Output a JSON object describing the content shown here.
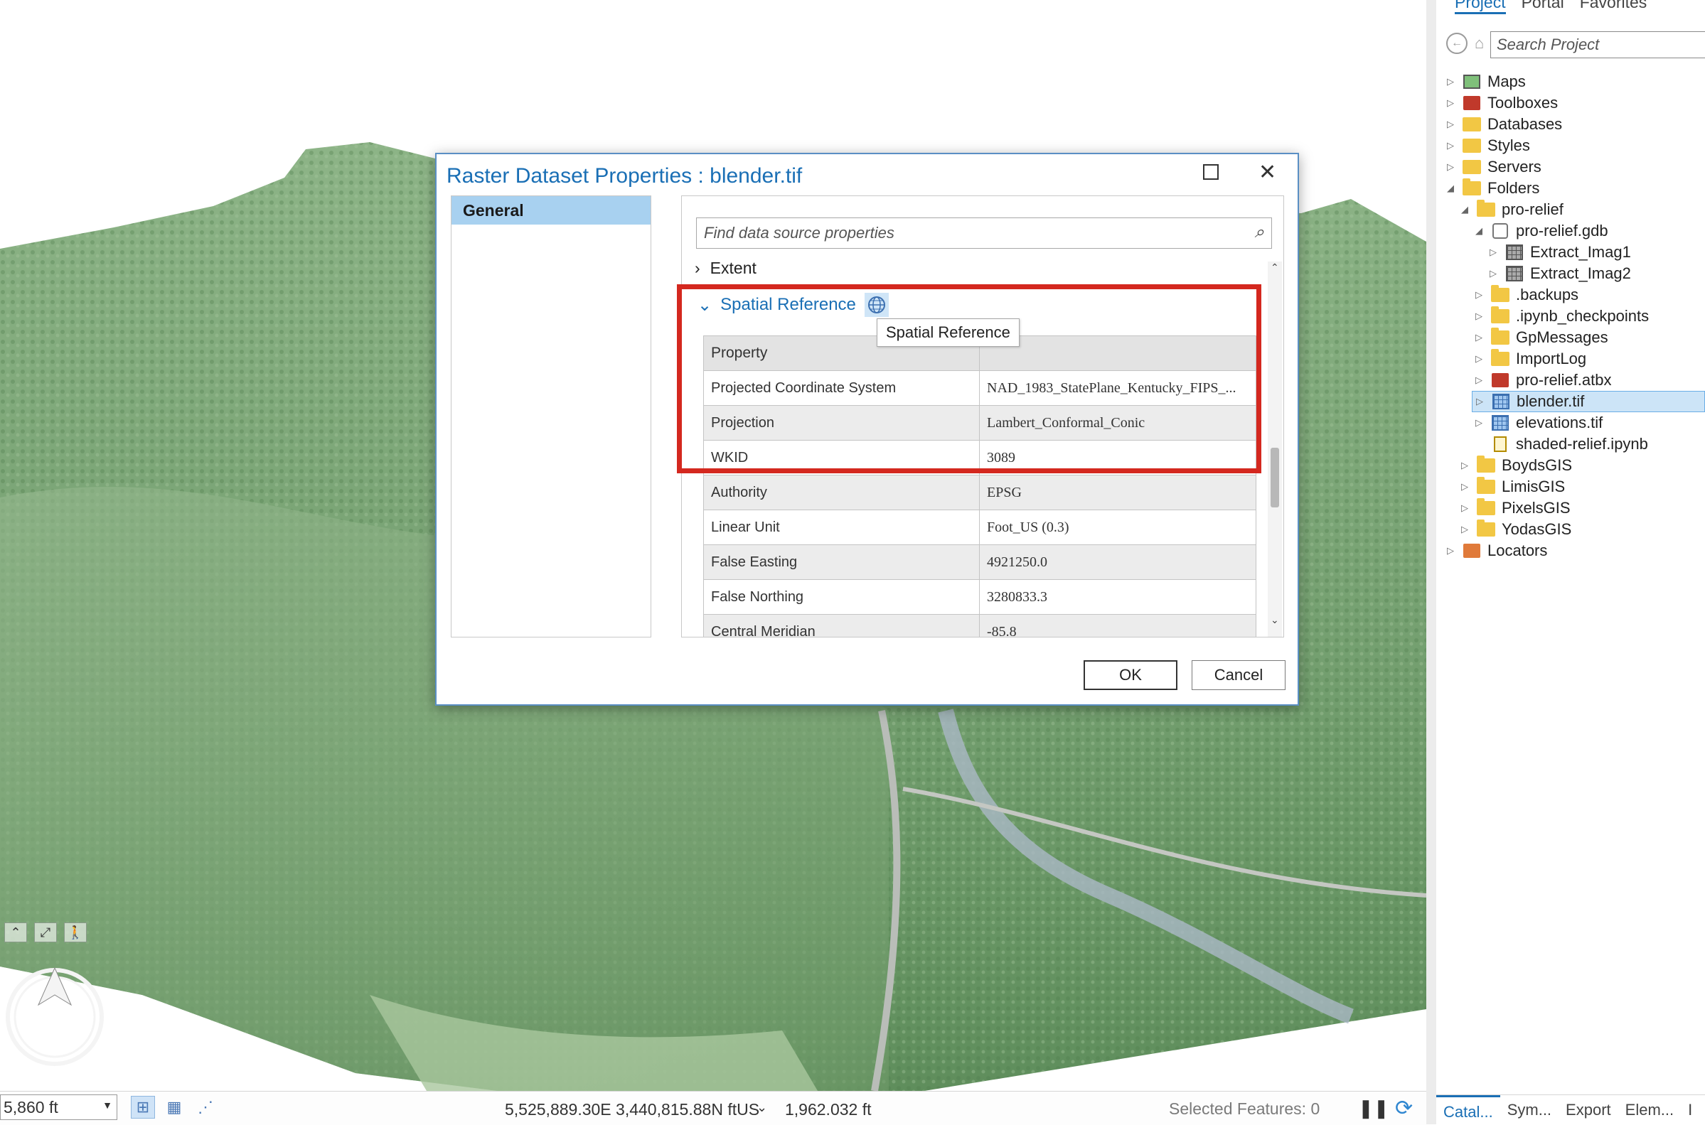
{
  "dialog": {
    "title": "Raster Dataset Properties : blender.tif",
    "nav_items": [
      "General"
    ],
    "search_placeholder": "Find data source properties",
    "extent_label": "Extent",
    "spatial_ref_label": "Spatial Reference",
    "tooltip": "Spatial Reference",
    "table": {
      "header": "Property",
      "rows": [
        {
          "property": "Projected Coordinate System",
          "value": "NAD_1983_StatePlane_Kentucky_FIPS_..."
        },
        {
          "property": "Projection",
          "value": "Lambert_Conformal_Conic"
        },
        {
          "property": "WKID",
          "value": "3089"
        },
        {
          "property": "Authority",
          "value": "EPSG"
        },
        {
          "property": "Linear Unit",
          "value": "Foot_US (0.3)"
        },
        {
          "property": "False Easting",
          "value": "4921250.0"
        },
        {
          "property": "False Northing",
          "value": "3280833.3"
        },
        {
          "property": "Central Meridian",
          "value": "-85.8"
        }
      ]
    },
    "ok_label": "OK",
    "cancel_label": "Cancel"
  },
  "status": {
    "scale": "5,860 ft",
    "coordinates": "5,525,889.30E 3,440,815.88N ftUS",
    "elevation": "1,962.032 ft",
    "selected_features": "Selected Features: 0"
  },
  "catalog": {
    "tabs": [
      "Project",
      "Portal",
      "Favorites"
    ],
    "search_placeholder": "Search Project",
    "tree": [
      {
        "label": "Maps"
      },
      {
        "label": "Toolboxes"
      },
      {
        "label": "Databases"
      },
      {
        "label": "Styles"
      },
      {
        "label": "Servers"
      },
      {
        "label": "Folders"
      },
      {
        "label": "pro-relief"
      },
      {
        "label": "pro-relief.gdb"
      },
      {
        "label": "Extract_Imag1"
      },
      {
        "label": "Extract_Imag2"
      },
      {
        "label": ".backups"
      },
      {
        "label": ".ipynb_checkpoints"
      },
      {
        "label": "GpMessages"
      },
      {
        "label": "ImportLog"
      },
      {
        "label": "pro-relief.atbx"
      },
      {
        "label": "blender.tif"
      },
      {
        "label": "elevations.tif"
      },
      {
        "label": "shaded-relief.ipynb"
      },
      {
        "label": "BoydsGIS"
      },
      {
        "label": "LimisGIS"
      },
      {
        "label": "PixelsGIS"
      },
      {
        "label": "YodasGIS"
      },
      {
        "label": "Locators"
      }
    ],
    "bottom_tabs": [
      "Catal...",
      "Sym...",
      "Export",
      "Elem...",
      "I"
    ]
  },
  "colors": {
    "accent": "#1a6fb5",
    "highlight": "#d4281f",
    "terrain": "#7fa872"
  },
  "icons": {
    "folder": "folder-icon",
    "raster": "raster-icon",
    "globe": "globe-icon",
    "search": "search-icon"
  }
}
